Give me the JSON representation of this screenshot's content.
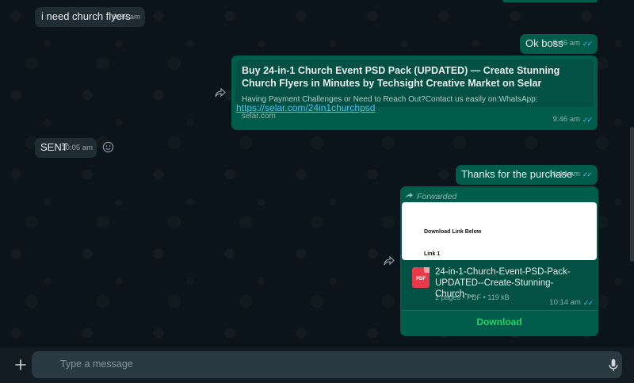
{
  "messages": {
    "m1": {
      "text": "i need church flyers",
      "time": "9:36 am"
    },
    "m2": {
      "text": "Ok boss",
      "time": "9:46 am"
    },
    "m3": {
      "preview_title": "Buy 24-in-1 Church Event PSD Pack (UPDATED) — Create Stunning Church Flyers in Minutes by Techsight Creative Market on Selar",
      "preview_desc": "Having Payment Challenges or Need to Reach Out?Contact us easily on:WhatsApp:",
      "preview_domain": "selar.com",
      "link": "https://selar.com/24in1churchpsd",
      "time": "9:46 am"
    },
    "m4": {
      "text": "SENT",
      "time": "10:05 am"
    },
    "m5": {
      "text": "Thanks for the purchase",
      "time": "10:14 am"
    },
    "m6": {
      "forwarded_label": "Forwarded",
      "doc_line1": "Download Link Below",
      "doc_line2": "Link 1",
      "file_name": "24-in-1-Church-Event-PSD-Pack-UPDATED--Create-Stunning-Church-...",
      "file_icon_label": "PDF",
      "meta": "2 pages • PDF • 119 kB",
      "time": "10:14 am",
      "download_label": "Download"
    }
  },
  "composer": {
    "placeholder": "Type a message"
  },
  "icons": {
    "add": "plus-icon",
    "sticker": "sticker-icon",
    "mic": "microphone-icon",
    "forward": "forward-icon",
    "react": "emoji-icon"
  },
  "colors": {
    "background": "#0b141a",
    "incoming": "#202c33",
    "outgoing": "#005c4b",
    "link": "#53bdeb",
    "download": "#25d366"
  }
}
